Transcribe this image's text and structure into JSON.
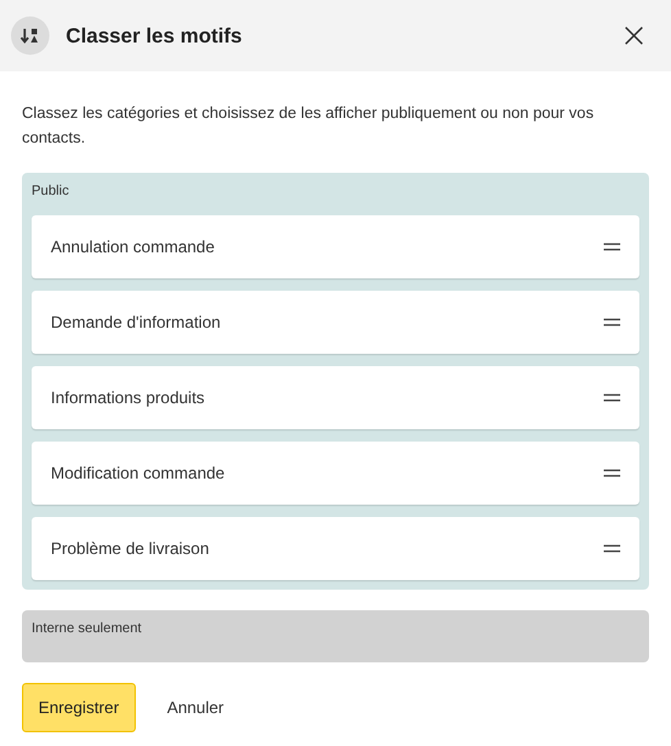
{
  "dialog": {
    "title": "Classer les motifs",
    "description": "Classez les catégories et choisissez de les afficher publiquement ou non pour vos contacts."
  },
  "sections": [
    {
      "label": "Public",
      "color": "#d3e5e5",
      "items": [
        {
          "label": "Annulation commande"
        },
        {
          "label": "Demande d'information"
        },
        {
          "label": "Informations produits"
        },
        {
          "label": "Modification commande"
        },
        {
          "label": "Problème de livraison"
        }
      ]
    },
    {
      "label": "Interne seulement",
      "color": "#d2d2d2"
    }
  ],
  "buttons": [
    {
      "label": "Enregistrer",
      "kind": "primary"
    },
    {
      "label": "Annuler",
      "kind": "link"
    }
  ]
}
